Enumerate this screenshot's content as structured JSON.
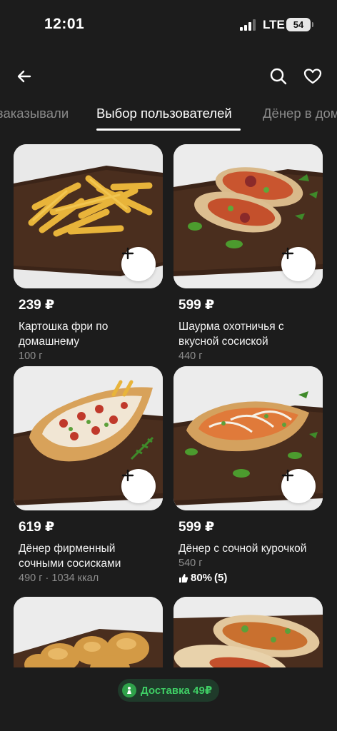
{
  "status_bar": {
    "time": "12:01",
    "network": "LTE",
    "battery": "54"
  },
  "toolbar": {
    "back_icon": "arrow-left-icon",
    "search_icon": "search-icon",
    "favorite_icon": "heart-icon"
  },
  "tabs": [
    {
      "label": "заказывали"
    },
    {
      "label": "Выбор пользователей"
    },
    {
      "label": "Дёнер в дом"
    }
  ],
  "products": [
    {
      "price": "239 ₽",
      "name": "Картошка фри по домашнему",
      "weight": "100 г"
    },
    {
      "price": "599 ₽",
      "name": "Шаурма охотничья с вкусной сосиской",
      "weight": "440 г"
    },
    {
      "price": "619 ₽",
      "name": "Дёнер фирменный сочными сосисками",
      "weight": "490 г · 1034 ккал"
    },
    {
      "price": "599 ₽",
      "name": "Дёнер с сочной курочкой",
      "weight": "540 г",
      "rating": "80%",
      "rating_count": "(5)"
    }
  ],
  "footer": {
    "delivery_label": "Доставка 49₽"
  },
  "colors": {
    "background": "#1c1c1c",
    "accent_green": "#3fce65",
    "pill_background": "#1f3a2a"
  }
}
